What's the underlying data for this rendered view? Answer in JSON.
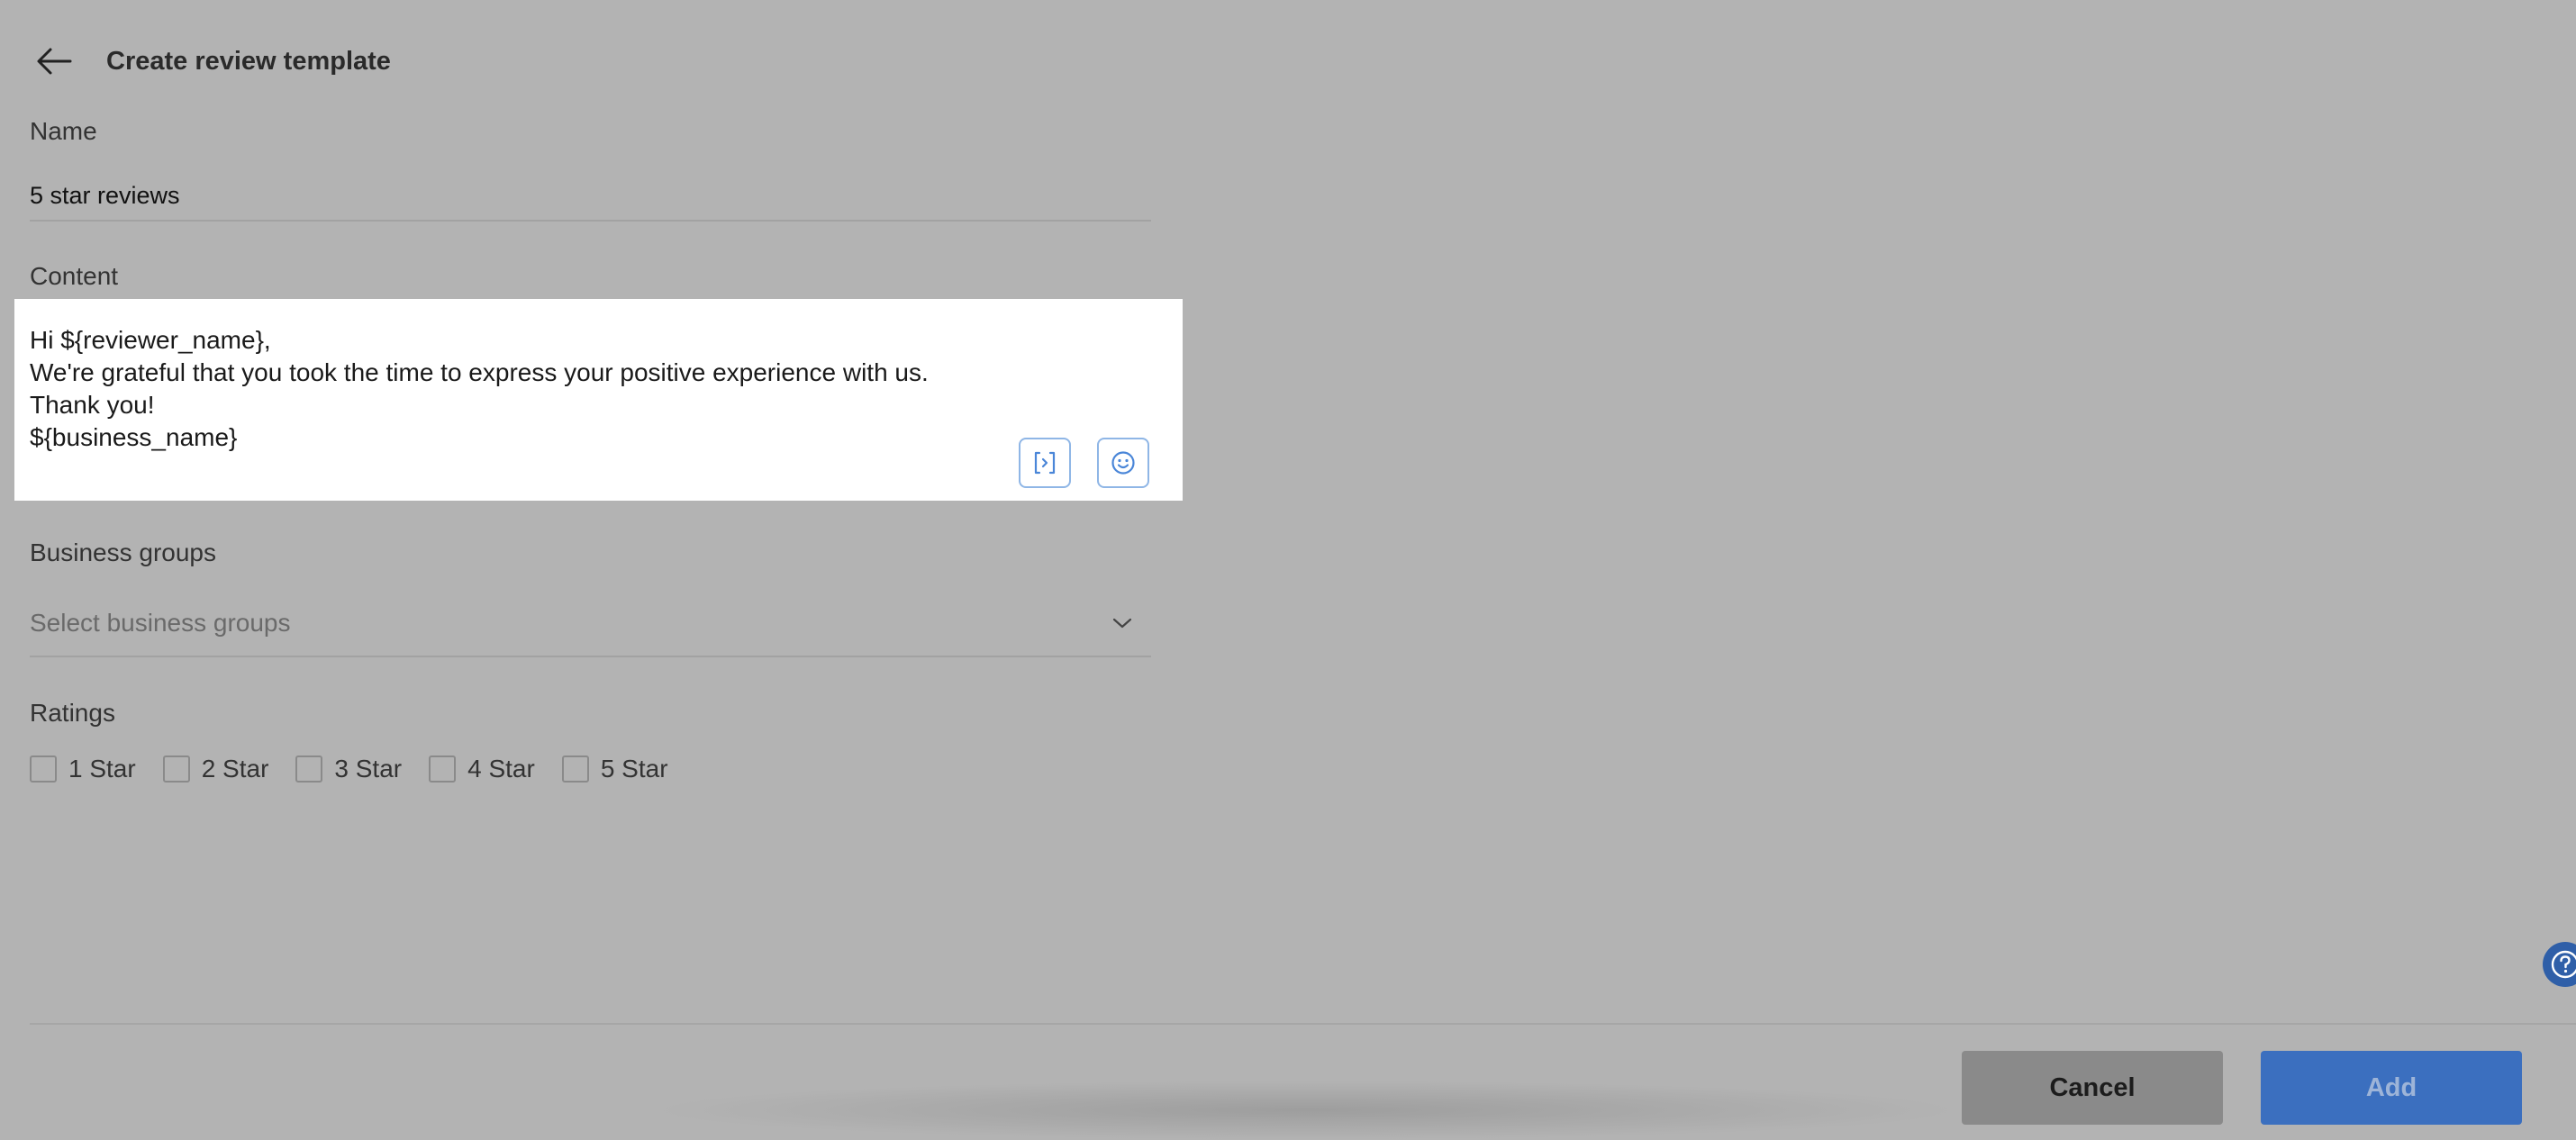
{
  "header": {
    "title": "Create review template"
  },
  "name_field": {
    "label": "Name",
    "value": "5 star reviews"
  },
  "content_field": {
    "label": "Content",
    "lines": [
      "Hi ${reviewer_name},",
      "We're grateful that you took the time to express your positive experience with us.",
      "Thank you!",
      "${business_name}"
    ],
    "tools": {
      "variable_icon": "code-variable-icon",
      "emoji_icon": "smiley-icon"
    }
  },
  "business_groups": {
    "label": "Business groups",
    "placeholder": "Select business groups"
  },
  "ratings": {
    "label": "Ratings",
    "options": [
      {
        "label": "1 Star",
        "checked": false
      },
      {
        "label": "2 Star",
        "checked": false
      },
      {
        "label": "3 Star",
        "checked": false
      },
      {
        "label": "4 Star",
        "checked": false
      },
      {
        "label": "5 Star",
        "checked": false
      }
    ]
  },
  "footer": {
    "cancel_label": "Cancel",
    "add_label": "Add"
  },
  "colors": {
    "overlay_bg": "#b3b3b3",
    "primary": "#3b6fbf",
    "cancel_bg": "#8a8a8a",
    "icon_accent": "#4a86d8"
  }
}
